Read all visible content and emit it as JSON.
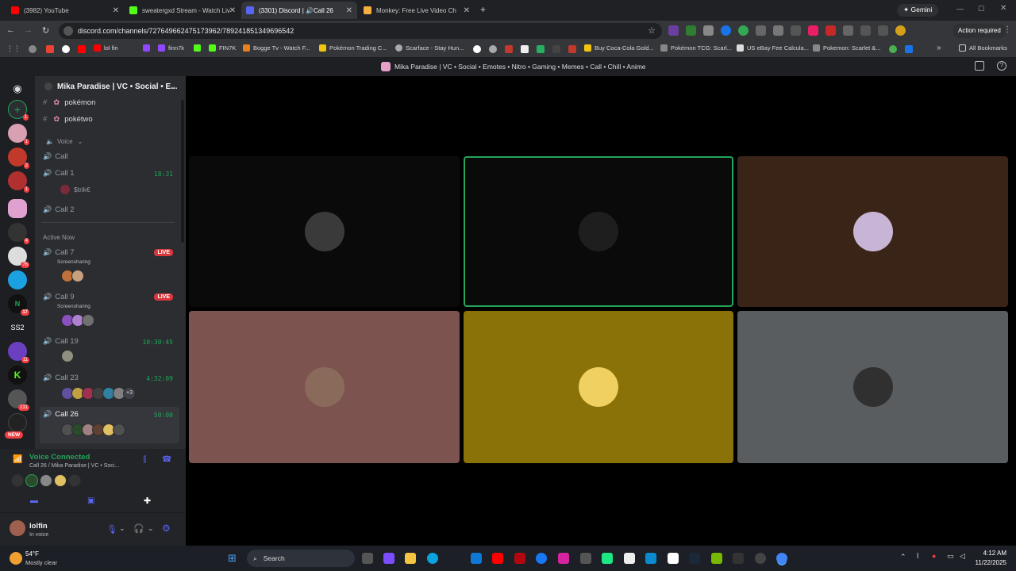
{
  "browser": {
    "tabs": [
      {
        "title": "(3982) YouTube",
        "color": "#ff0000"
      },
      {
        "title": "sweatergxd Stream - Watch Liv",
        "color": "#53fc18"
      },
      {
        "title": "(3301) Discord | 🔊Call 26",
        "color": "#5865f2"
      },
      {
        "title": "Monkey: Free Live Video Ch",
        "color": "#f5b041"
      }
    ],
    "new_tab": "+",
    "gemini": "Gemini",
    "url": "discord.com/channels/727649662475173962/789241851349696542",
    "action_required": "Action required",
    "bookmarks": [
      {
        "label": "lol fin",
        "color": "#ff0000"
      },
      {
        "label": "finn7k",
        "color": "#9146ff"
      },
      {
        "label": "FIN7K",
        "color": "#53fc18"
      },
      {
        "label": "Bogge Tv - Watch F...",
        "color": "#e67e22"
      },
      {
        "label": "Pokémon Trading C...",
        "color": "#f1c40f"
      },
      {
        "label": "Scarface - Stay Hun...",
        "color": "#aaaaaa"
      },
      {
        "label": "Buy Coca-Cola Gold...",
        "color": "#f1c40f"
      },
      {
        "label": "Pokémon TCG: Scarl...",
        "color": "#888888"
      },
      {
        "label": "US eBay Fee Calcula...",
        "color": "#dddddd"
      },
      {
        "label": "Pokemon: Scarlet &...",
        "color": "#888888"
      }
    ],
    "all_bookmarks": "All Bookmarks"
  },
  "titlebar": {
    "title": "Mika Paradise | VC • Social • Emotes • Nitro • Gaming • Memes • Call • Chill • Anime"
  },
  "server": {
    "name": "Mika Paradise | VC • Social • E..."
  },
  "channels": {
    "text": [
      {
        "label": "pokémon"
      },
      {
        "label": "pokétwo"
      }
    ],
    "voice_category": "Voice",
    "voice": [
      {
        "label": "Call",
        "time": ""
      },
      {
        "label": "Call 1",
        "time": "18:31"
      },
      {
        "label": "Call 2",
        "time": ""
      }
    ],
    "call1_member": "$trik€",
    "active_now": "Active Now",
    "active": [
      {
        "label": "Call 7",
        "badge": "LIVE",
        "sub": "Screensharing",
        "time": ""
      },
      {
        "label": "Call 9",
        "badge": "LIVE",
        "sub": "Screensharing",
        "time": ""
      },
      {
        "label": "Call 19",
        "badge": "",
        "sub": "",
        "time": "10:30:45"
      },
      {
        "label": "Call 23",
        "badge": "",
        "sub": "",
        "time": "4:32:09",
        "more": "+3"
      },
      {
        "label": "Call 26",
        "badge": "",
        "sub": "",
        "time": "50:00"
      }
    ]
  },
  "guild_badges": [
    "1",
    "1",
    "2",
    "1",
    "4",
    "76",
    "17",
    "11",
    "131"
  ],
  "guild_labels": {
    "ss2": "SS2",
    "new": "NEW"
  },
  "voice_panel": {
    "status": "Voice Connected",
    "location": "Call 26 / Mika Paradise | VC • Soci...",
    "user": "lolfin",
    "user_status": "In voice"
  },
  "tiles": [
    {
      "color": "#0a0a0a",
      "avatar": "#3a3a3a",
      "speaking": false
    },
    {
      "color": "#0a0a0a",
      "avatar": "#1e1e1e",
      "speaking": true
    },
    {
      "color": "#3a2418",
      "avatar": "#c8b4d4",
      "speaking": false
    },
    {
      "color": "#7d5350",
      "avatar": "#8a6a5a",
      "speaking": false
    },
    {
      "color": "#8a7208",
      "avatar": "#f0d060",
      "speaking": false
    },
    {
      "color": "#5a5d60",
      "avatar": "#303030",
      "speaking": false
    }
  ],
  "taskbar": {
    "temp": "54°F",
    "weather": "Mostly clear",
    "search": "Search",
    "time": "4:12 AM",
    "date": "11/22/2025"
  }
}
